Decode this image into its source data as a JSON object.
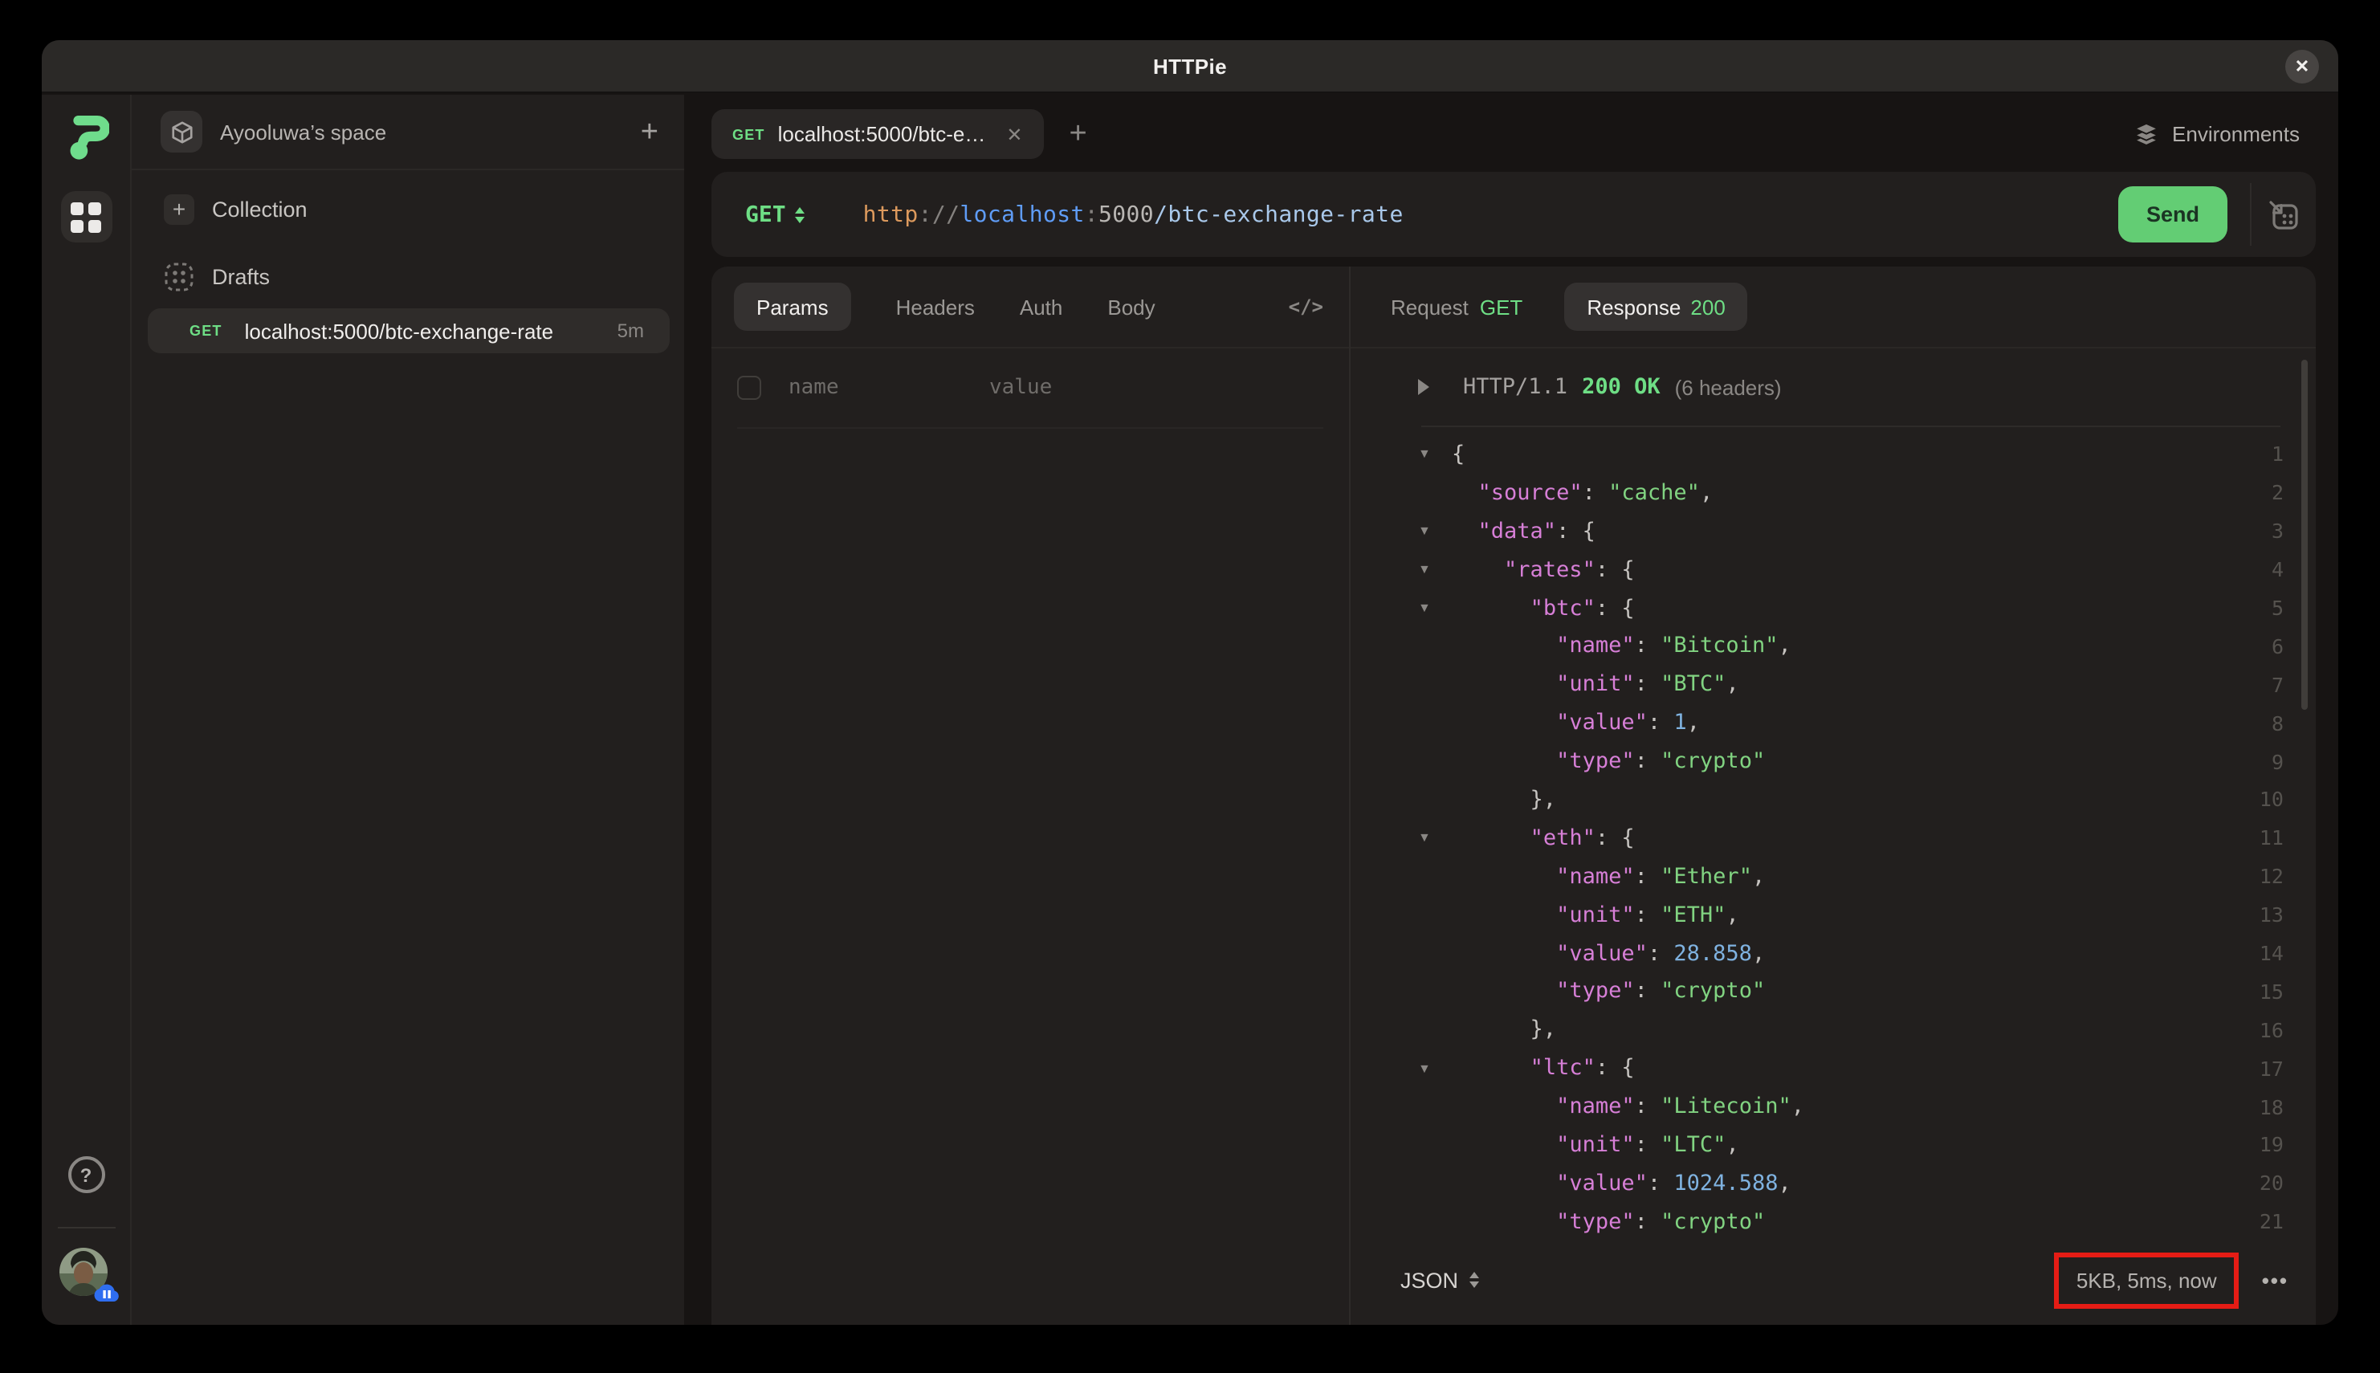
{
  "window": {
    "title": "HTTPie",
    "close_label": "✕"
  },
  "colors": {
    "accent_green": "#6ede85",
    "send_button_bg": "#63cd74",
    "annotation_red": "#e51c15",
    "json_key": "#d77fd7",
    "json_string": "#81d381",
    "json_number": "#7fb2e0",
    "panel_bg": "#221f1e"
  },
  "sidebar": {
    "space": {
      "name": "Ayooluwa’s space",
      "add_label": "+"
    },
    "collection_label": "Collection",
    "collection_plus": "+",
    "drafts_label": "Drafts",
    "request": {
      "method": "GET",
      "url": "localhost:5000/btc-exchange-rate",
      "age": "5m"
    }
  },
  "tabstrip": {
    "tab": {
      "method": "GET",
      "title": "localhost:5000/btc-e…",
      "close_label": "✕"
    },
    "new_tab_label": "+",
    "environments_label": "Environments"
  },
  "url_bar": {
    "method": "GET",
    "url_segments": [
      {
        "t": "http",
        "c": "#dd9a5d"
      },
      {
        "t": "://",
        "c": "#85827f"
      },
      {
        "t": "localhost",
        "c": "#5f9cf6"
      },
      {
        "t": ":",
        "c": "#85827f"
      },
      {
        "t": "5000",
        "c": "#b9b6b3"
      },
      {
        "t": "/btc-exchange-rate",
        "c": "#a9c8ea"
      }
    ],
    "send_label": "Send"
  },
  "request_panel": {
    "active_tab": "Params",
    "other_tabs": [
      "Headers",
      "Auth",
      "Body"
    ],
    "code_toggle_label": "</>",
    "name_placeholder": "name",
    "value_placeholder": "value"
  },
  "response_panel": {
    "request_tab": {
      "label": "Request",
      "method": "GET"
    },
    "response_tab": {
      "label": "Response",
      "status": "200"
    },
    "status_line": {
      "protocol": "HTTP/1.1",
      "status": "200 OK",
      "headers_note": "(6 headers)"
    },
    "body_lines": [
      {
        "n": "1",
        "c": true,
        "segs": [
          [
            "p",
            "{"
          ]
        ]
      },
      {
        "n": "2",
        "c": false,
        "segs": [
          [
            "p",
            "  "
          ],
          [
            "k",
            "\"source\""
          ],
          [
            "p",
            ": "
          ],
          [
            "s",
            "\"cache\""
          ],
          [
            "p",
            ","
          ]
        ]
      },
      {
        "n": "3",
        "c": true,
        "segs": [
          [
            "p",
            "  "
          ],
          [
            "k",
            "\"data\""
          ],
          [
            "p",
            ": {"
          ]
        ]
      },
      {
        "n": "4",
        "c": true,
        "segs": [
          [
            "p",
            "    "
          ],
          [
            "k",
            "\"rates\""
          ],
          [
            "p",
            ": {"
          ]
        ]
      },
      {
        "n": "5",
        "c": true,
        "segs": [
          [
            "p",
            "      "
          ],
          [
            "k",
            "\"btc\""
          ],
          [
            "p",
            ": {"
          ]
        ]
      },
      {
        "n": "6",
        "c": false,
        "segs": [
          [
            "p",
            "        "
          ],
          [
            "k",
            "\"name\""
          ],
          [
            "p",
            ": "
          ],
          [
            "s",
            "\"Bitcoin\""
          ],
          [
            "p",
            ","
          ]
        ]
      },
      {
        "n": "7",
        "c": false,
        "segs": [
          [
            "p",
            "        "
          ],
          [
            "k",
            "\"unit\""
          ],
          [
            "p",
            ": "
          ],
          [
            "s",
            "\"BTC\""
          ],
          [
            "p",
            ","
          ]
        ]
      },
      {
        "n": "8",
        "c": false,
        "segs": [
          [
            "p",
            "        "
          ],
          [
            "k",
            "\"value\""
          ],
          [
            "p",
            ": "
          ],
          [
            "n",
            "1"
          ],
          [
            "p",
            ","
          ]
        ]
      },
      {
        "n": "9",
        "c": false,
        "segs": [
          [
            "p",
            "        "
          ],
          [
            "k",
            "\"type\""
          ],
          [
            "p",
            ": "
          ],
          [
            "s",
            "\"crypto\""
          ]
        ]
      },
      {
        "n": "10",
        "c": false,
        "segs": [
          [
            "p",
            "      },"
          ]
        ]
      },
      {
        "n": "11",
        "c": true,
        "segs": [
          [
            "p",
            "      "
          ],
          [
            "k",
            "\"eth\""
          ],
          [
            "p",
            ": {"
          ]
        ]
      },
      {
        "n": "12",
        "c": false,
        "segs": [
          [
            "p",
            "        "
          ],
          [
            "k",
            "\"name\""
          ],
          [
            "p",
            ": "
          ],
          [
            "s",
            "\"Ether\""
          ],
          [
            "p",
            ","
          ]
        ]
      },
      {
        "n": "13",
        "c": false,
        "segs": [
          [
            "p",
            "        "
          ],
          [
            "k",
            "\"unit\""
          ],
          [
            "p",
            ": "
          ],
          [
            "s",
            "\"ETH\""
          ],
          [
            "p",
            ","
          ]
        ]
      },
      {
        "n": "14",
        "c": false,
        "segs": [
          [
            "p",
            "        "
          ],
          [
            "k",
            "\"value\""
          ],
          [
            "p",
            ": "
          ],
          [
            "n",
            "28.858"
          ],
          [
            "p",
            ","
          ]
        ]
      },
      {
        "n": "15",
        "c": false,
        "segs": [
          [
            "p",
            "        "
          ],
          [
            "k",
            "\"type\""
          ],
          [
            "p",
            ": "
          ],
          [
            "s",
            "\"crypto\""
          ]
        ]
      },
      {
        "n": "16",
        "c": false,
        "segs": [
          [
            "p",
            "      },"
          ]
        ]
      },
      {
        "n": "17",
        "c": true,
        "segs": [
          [
            "p",
            "      "
          ],
          [
            "k",
            "\"ltc\""
          ],
          [
            "p",
            ": {"
          ]
        ]
      },
      {
        "n": "18",
        "c": false,
        "segs": [
          [
            "p",
            "        "
          ],
          [
            "k",
            "\"name\""
          ],
          [
            "p",
            ": "
          ],
          [
            "s",
            "\"Litecoin\""
          ],
          [
            "p",
            ","
          ]
        ]
      },
      {
        "n": "19",
        "c": false,
        "segs": [
          [
            "p",
            "        "
          ],
          [
            "k",
            "\"unit\""
          ],
          [
            "p",
            ": "
          ],
          [
            "s",
            "\"LTC\""
          ],
          [
            "p",
            ","
          ]
        ]
      },
      {
        "n": "20",
        "c": false,
        "segs": [
          [
            "p",
            "        "
          ],
          [
            "k",
            "\"value\""
          ],
          [
            "p",
            ": "
          ],
          [
            "n",
            "1024.588"
          ],
          [
            "p",
            ","
          ]
        ]
      },
      {
        "n": "21",
        "c": false,
        "segs": [
          [
            "p",
            "        "
          ],
          [
            "k",
            "\"type\""
          ],
          [
            "p",
            ": "
          ],
          [
            "s",
            "\"crypto\""
          ]
        ]
      }
    ],
    "footer": {
      "format": "JSON",
      "meta": "5KB, 5ms, now",
      "more_label": "•••"
    }
  }
}
